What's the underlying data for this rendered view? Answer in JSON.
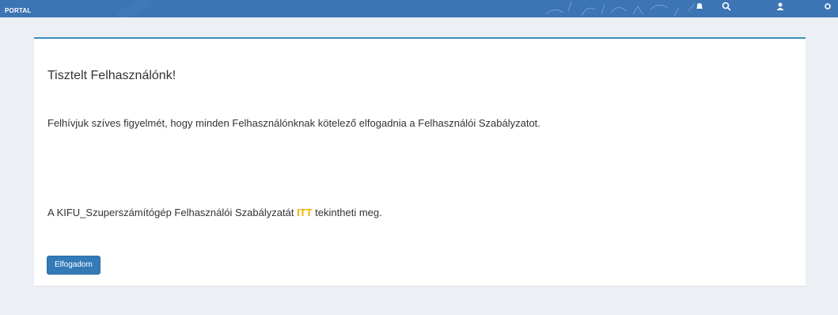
{
  "header": {
    "portal_label": "PORTAL"
  },
  "card": {
    "greeting": "Tisztelt Felhasználónk!",
    "notice": "Felhívjuk szíves figyelmét, hogy minden Felhasználónknak kötelező elfogadnia a Felhasználói Szabályzatot.",
    "policy_prefix": "A KIFU_Szuperszámítógép Felhasználói Szabályzatát ",
    "policy_link": "ITT",
    "policy_suffix": " tekintheti meg.",
    "accept_button": "Elfogadom"
  },
  "colors": {
    "header_bg": "#3c74b4",
    "card_border": "#3c8dbc",
    "link": "#f0b000",
    "button": "#337ab7",
    "page_bg": "#ecf0f5"
  }
}
